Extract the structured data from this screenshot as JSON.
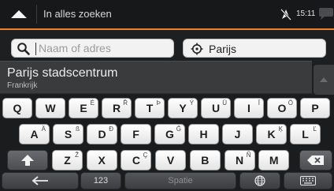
{
  "topbar": {
    "title": "In alles zoeken",
    "time": "15:11",
    "icons": [
      "up-arrow-icon",
      "gps-off-icon",
      "message-icon"
    ]
  },
  "search": {
    "placeholder": "Naam of adres",
    "value": "",
    "city_label": "Parijs"
  },
  "result": {
    "title": "Parijs stadscentrum",
    "subtitle": "Frankrijk"
  },
  "keyboard": {
    "row1": [
      {
        "k": "Q",
        "a": ""
      },
      {
        "k": "W",
        "a": ""
      },
      {
        "k": "E",
        "a": "É"
      },
      {
        "k": "R",
        "a": "Ř"
      },
      {
        "k": "T",
        "a": "Þ"
      },
      {
        "k": "Y",
        "a": "Ý"
      },
      {
        "k": "U",
        "a": "Ü"
      },
      {
        "k": "I",
        "a": "Ï"
      },
      {
        "k": "O",
        "a": "Ö"
      },
      {
        "k": "P",
        "a": ""
      }
    ],
    "row2": [
      {
        "k": "A",
        "a": "Ä"
      },
      {
        "k": "S",
        "a": "ß"
      },
      {
        "k": "D",
        "a": "Ð"
      },
      {
        "k": "F",
        "a": ""
      },
      {
        "k": "G",
        "a": "Ğ"
      },
      {
        "k": "H",
        "a": ""
      },
      {
        "k": "J",
        "a": ""
      },
      {
        "k": "K",
        "a": "Ķ"
      },
      {
        "k": "L",
        "a": "Ľ"
      }
    ],
    "row3": [
      {
        "k": "Z",
        "a": "Ž"
      },
      {
        "k": "X",
        "a": ""
      },
      {
        "k": "C",
        "a": "Ç"
      },
      {
        "k": "V",
        "a": ""
      },
      {
        "k": "B",
        "a": ""
      },
      {
        "k": "N",
        "a": "Ñ"
      },
      {
        "k": "M",
        "a": ""
      }
    ],
    "numbers_label": "123",
    "space_label": "Spatie"
  },
  "colors": {
    "accent": "#e8822a",
    "background": "#1e1f21",
    "key_light": "#f2f2f2",
    "key_dark": "#4c4d50"
  }
}
